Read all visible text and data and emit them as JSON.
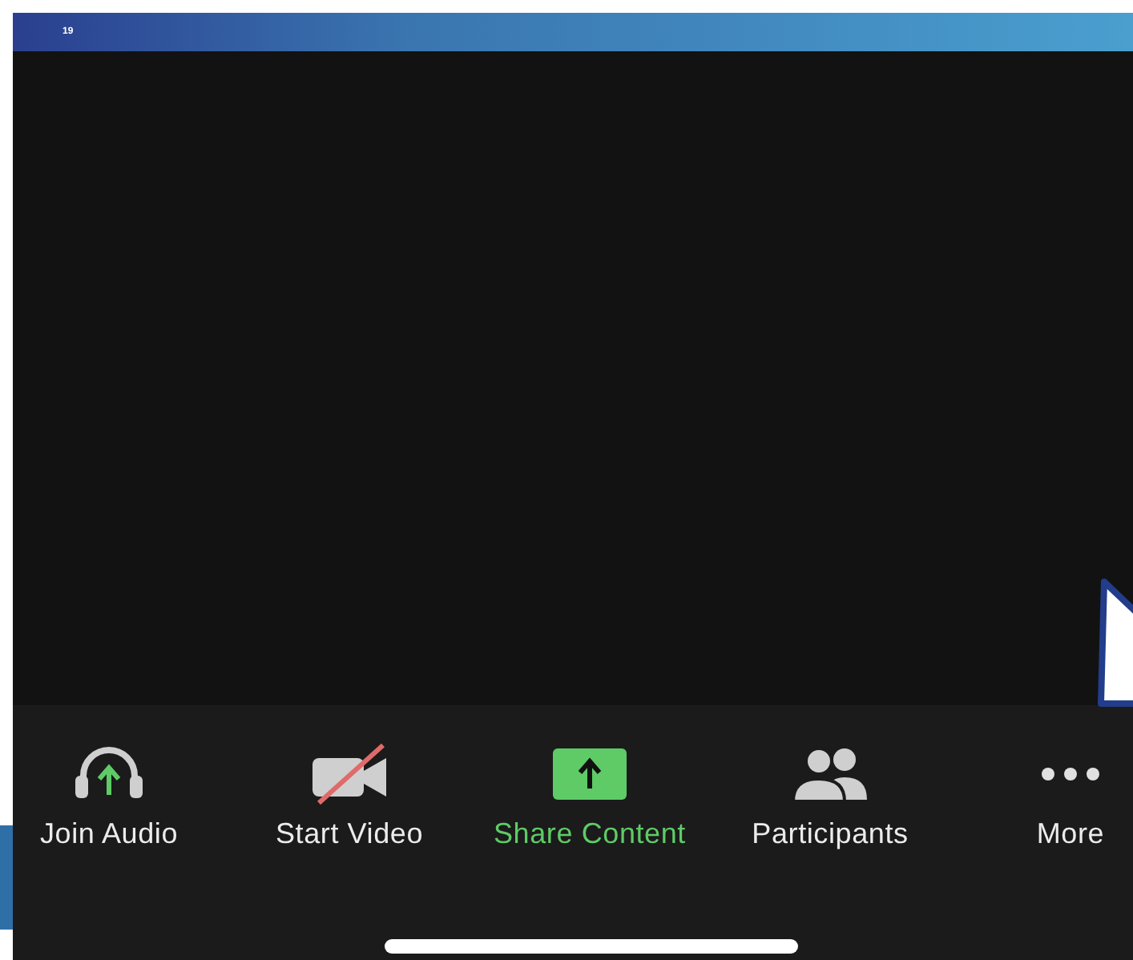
{
  "slide": {
    "number": "19"
  },
  "toolbar": {
    "items": [
      {
        "kind": "audio",
        "label": "Join Audio",
        "selected": false
      },
      {
        "kind": "video",
        "label": "Start Video",
        "selected": false
      },
      {
        "kind": "share",
        "label": "Share Content",
        "selected": true
      },
      {
        "kind": "participants",
        "label": "Participants",
        "selected": false
      },
      {
        "kind": "more",
        "label": "More",
        "selected": false
      }
    ]
  }
}
